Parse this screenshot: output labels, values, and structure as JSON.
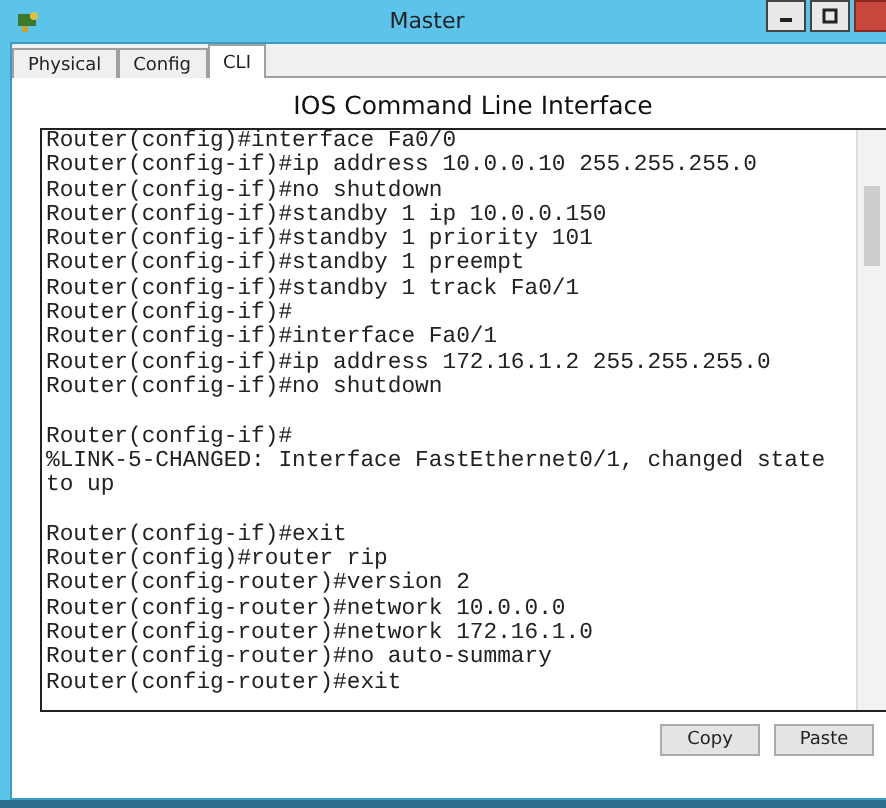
{
  "window": {
    "title": "Master"
  },
  "tabs": [
    {
      "label": "Physical",
      "selected": false
    },
    {
      "label": "Config",
      "selected": false
    },
    {
      "label": "CLI",
      "selected": true
    }
  ],
  "heading": "IOS Command Line Interface",
  "console_lines": [
    {
      "kind": "text",
      "text": "Router(config)#interface Fa0/0"
    },
    {
      "kind": "text",
      "text": "Router(config-if)#ip address 10.0.0.10 255.255.255.0"
    },
    {
      "kind": "text",
      "text": "Router(config-if)#no shutdown"
    },
    {
      "kind": "text",
      "text": "Router(config-if)#standby 1 ip 10.0.0.150"
    },
    {
      "kind": "text",
      "text": "Router(config-if)#standby 1 priority 101"
    },
    {
      "kind": "text",
      "text": "Router(config-if)#standby 1 preempt"
    },
    {
      "kind": "text",
      "text": "Router(config-if)#standby 1 track Fa0/1"
    },
    {
      "kind": "text",
      "text": "Router(config-if)#"
    },
    {
      "kind": "text",
      "text": "Router(config-if)#interface Fa0/1"
    },
    {
      "kind": "text",
      "text": "Router(config-if)#ip address 172.16.1.2 255.255.255.0"
    },
    {
      "kind": "text",
      "text": "Router(config-if)#no shutdown"
    },
    {
      "kind": "blank"
    },
    {
      "kind": "text",
      "text": "Router(config-if)#"
    },
    {
      "kind": "text",
      "text": "%LINK-5-CHANGED: Interface FastEthernet0/1, changed state"
    },
    {
      "kind": "text",
      "text": "to up"
    },
    {
      "kind": "blank"
    },
    {
      "kind": "text",
      "text": "Router(config-if)#exit"
    },
    {
      "kind": "text",
      "text": "Router(config)#router rip"
    },
    {
      "kind": "text",
      "text": "Router(config-router)#version 2"
    },
    {
      "kind": "text",
      "text": "Router(config-router)#network 10.0.0.0"
    },
    {
      "kind": "text",
      "text": "Router(config-router)#network 172.16.1.0"
    },
    {
      "kind": "text",
      "text": "Router(config-router)#no auto-summary"
    },
    {
      "kind": "text",
      "text": "Router(config-router)#exit"
    }
  ],
  "buttons": [
    {
      "label": "Copy"
    },
    {
      "label": "Paste"
    }
  ]
}
